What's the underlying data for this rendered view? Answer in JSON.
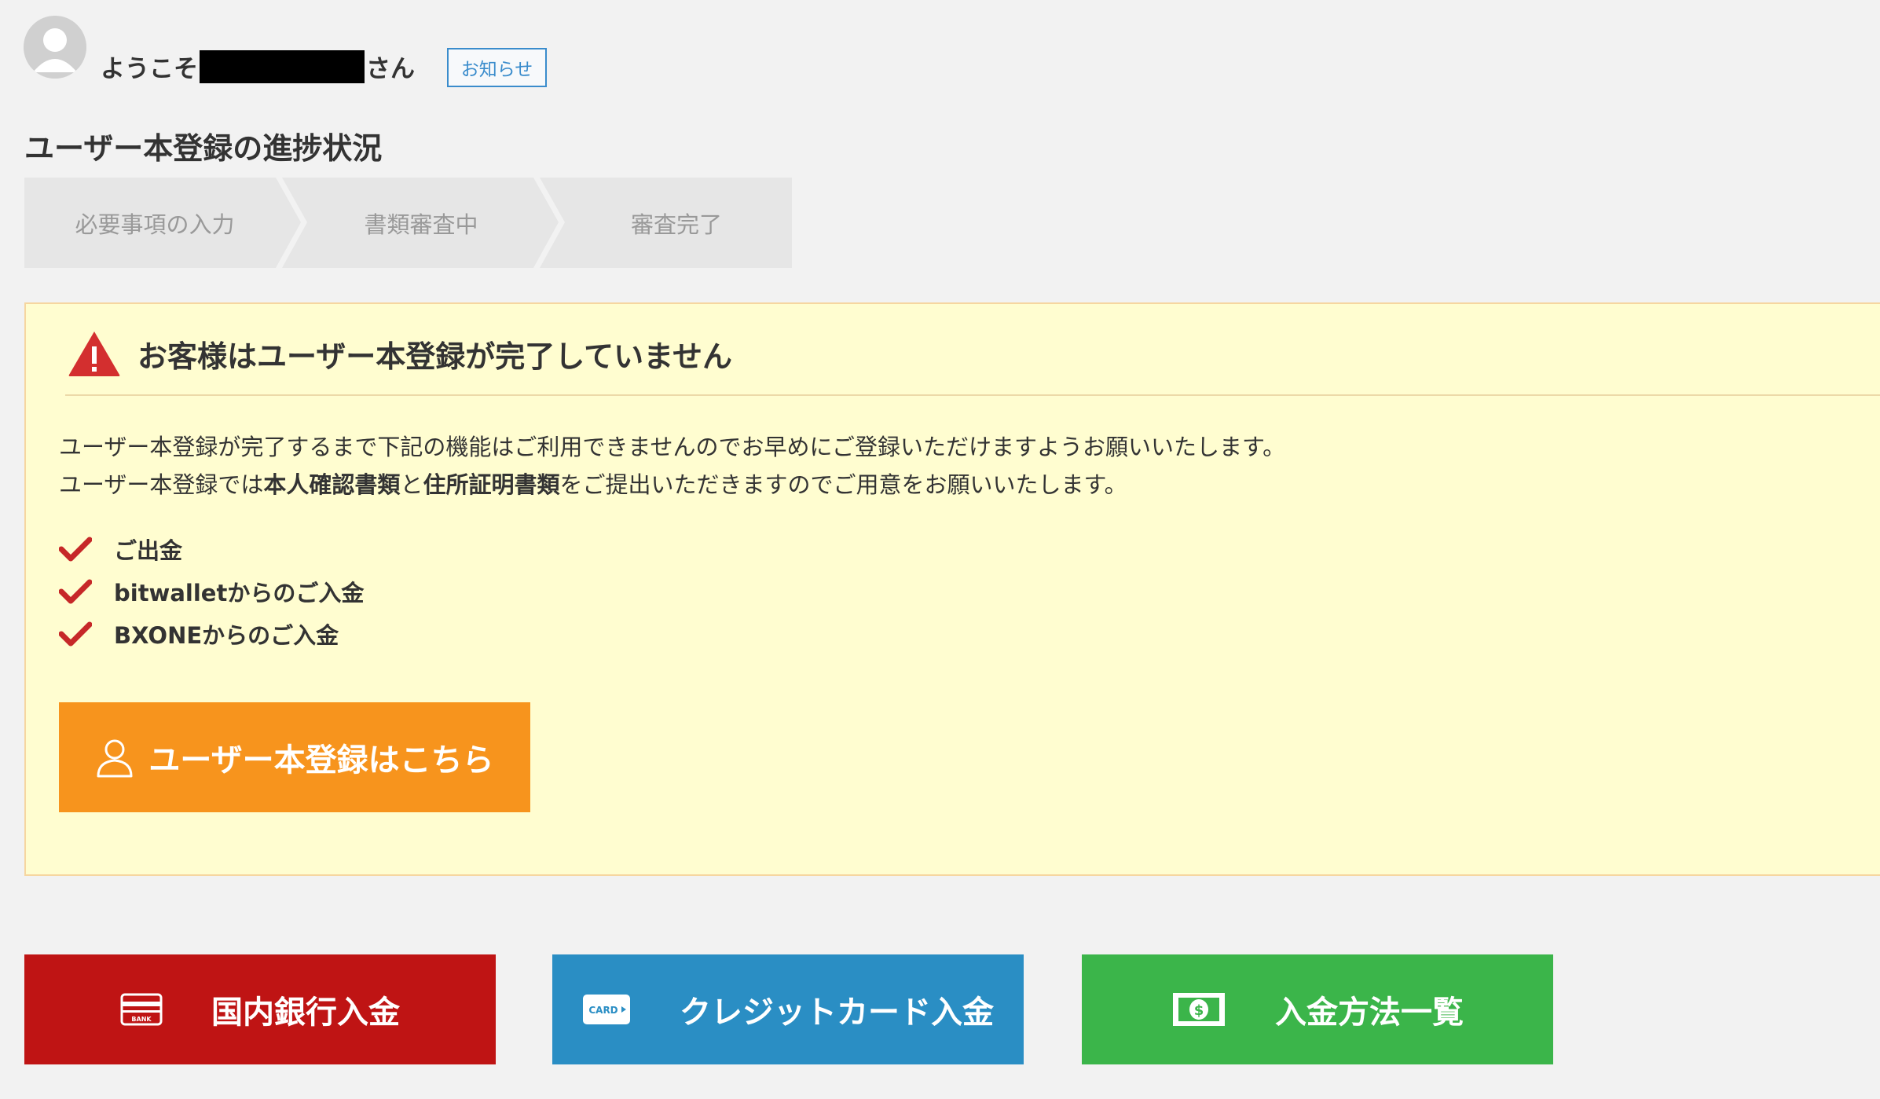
{
  "header": {
    "welcome_prefix": "ようこそ",
    "welcome_suffix": "さん",
    "notice_label": "お知らせ"
  },
  "progress": {
    "title": "ユーザー本登録の進捗状況",
    "steps": [
      {
        "label": "必要事項の入力"
      },
      {
        "label": "書類審査中"
      },
      {
        "label": "審査完了"
      }
    ]
  },
  "alert": {
    "title": "お客様はユーザー本登録が完了していません",
    "line1": "ユーザー本登録が完了するまで下記の機能はご利用できませんのでお早めにご登録いただけますようお願いいたします。",
    "line2_a": "ユーザー本登録では",
    "line2_b": "本人確認書類",
    "line2_c": "と",
    "line2_d": "住所証明書類",
    "line2_e": "をご提出いただきますのでご用意をお願いいたします。",
    "features": [
      {
        "label": "ご出金"
      },
      {
        "label": "bitwalletからのご入金"
      },
      {
        "label": "BXONEからのご入金"
      }
    ],
    "register_label": "ユーザー本登録はこちら"
  },
  "deposit_buttons": {
    "bank_label": "国内銀行入金",
    "bank_icon_text": "BANK",
    "card_label": "クレジットカード入金",
    "card_icon_text": "CARD",
    "list_label": "入金方法一覧",
    "list_icon_text": "$"
  },
  "colors": {
    "background": "#f2f2f2",
    "alert_bg": "#fffdd0",
    "warning_red": "#d32f2f",
    "check_red": "#c62828",
    "register_orange": "#f7941d",
    "bank_red": "#bf1414",
    "card_blue": "#2a8ec4",
    "list_green": "#3bb54a",
    "notice_blue": "#3a8ccc"
  },
  "icons": {
    "avatar": "user-avatar-icon",
    "warning": "warning-triangle-icon",
    "check": "check-icon",
    "user": "user-outline-icon",
    "bank": "bank-card-icon",
    "card": "credit-card-icon",
    "money": "money-bill-icon"
  }
}
